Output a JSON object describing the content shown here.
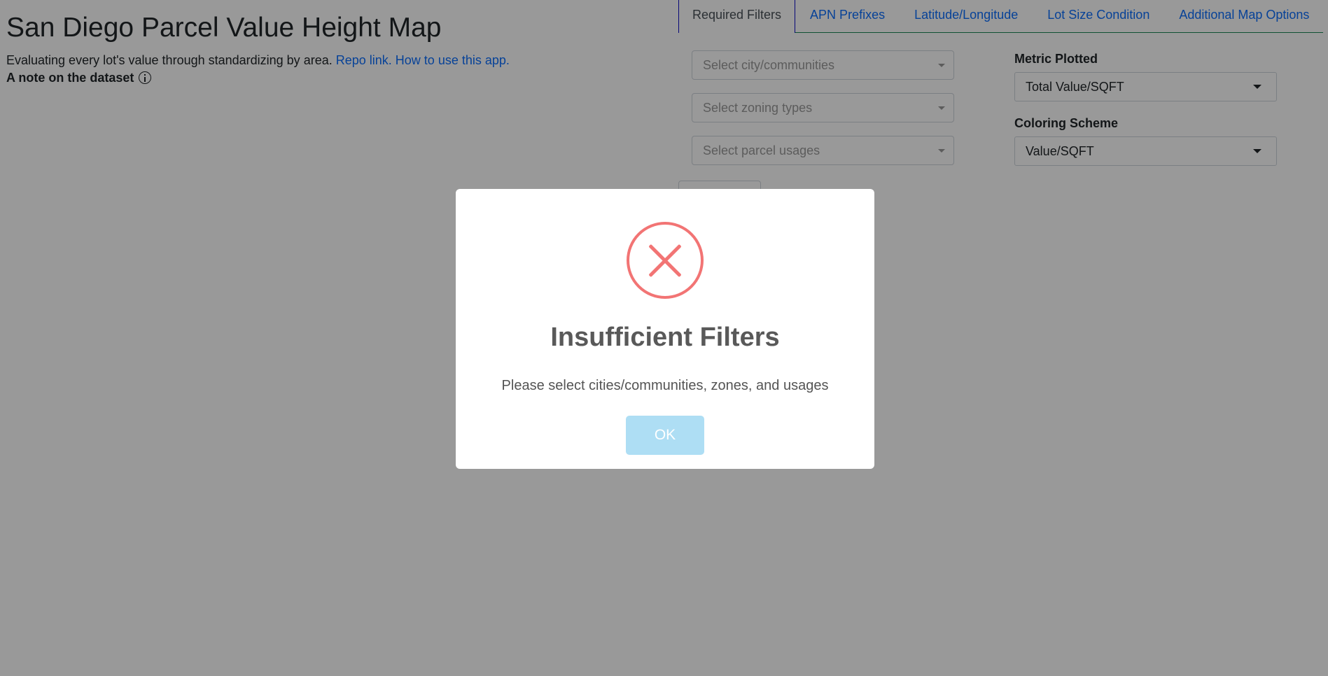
{
  "header": {
    "title": "San Diego Parcel Value Height Map",
    "subtitle_text": "Evaluating every lot's value through standardizing by area.",
    "repo_link": "Repo link.",
    "howto_link": "How to use this app.",
    "note_text": "A note on the dataset"
  },
  "tabs": [
    {
      "label": "Required Filters"
    },
    {
      "label": "APN Prefixes"
    },
    {
      "label": "Latitude/Longitude"
    },
    {
      "label": "Lot Size Condition"
    },
    {
      "label": "Additional Map Options"
    }
  ],
  "filters": {
    "city_placeholder": "Select city/communities",
    "zoning_placeholder": "Select zoning types",
    "usage_placeholder": "Select parcel usages"
  },
  "options": {
    "metric_label": "Metric Plotted",
    "metric_value": "Total Value/SQFT",
    "coloring_label": "Coloring Scheme",
    "coloring_value": "Value/SQFT"
  },
  "modal": {
    "title": "Insufficient Filters",
    "message": "Please select cities/communities, zones, and usages",
    "ok_label": "OK"
  }
}
